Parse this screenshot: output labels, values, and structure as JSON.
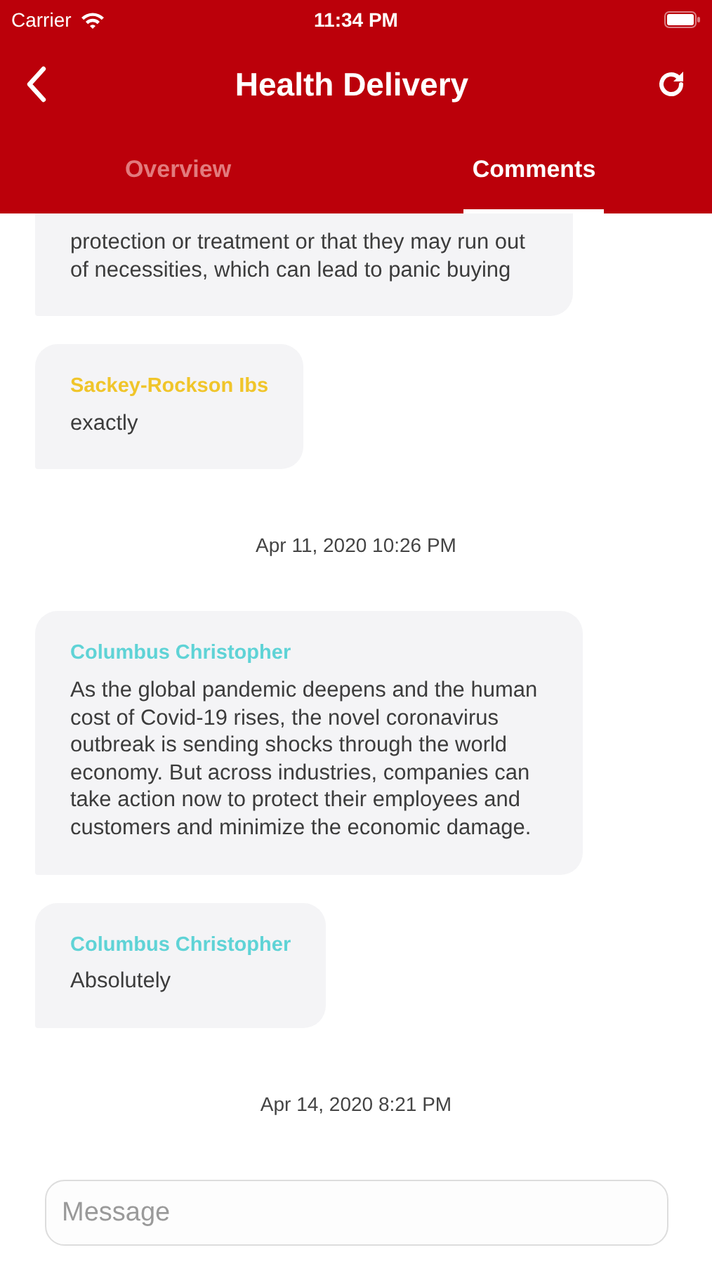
{
  "status_bar": {
    "carrier": "Carrier",
    "time": "11:34 PM"
  },
  "header": {
    "title": "Health Delivery"
  },
  "tabs": [
    {
      "label": "Overview",
      "selected": false
    },
    {
      "label": "Comments",
      "selected": true
    }
  ],
  "messages": [
    {
      "kind": "message",
      "text": "protection or treatment or that they may run out of necessities, which can lead to panic buying"
    },
    {
      "kind": "message",
      "author": "Sackey-Rockson  Ibs",
      "color": "#f0c52a",
      "text": "exactly"
    },
    {
      "kind": "timestamp",
      "text": "Apr 11, 2020 10:26 PM"
    },
    {
      "kind": "message",
      "author": "Columbus Christopher",
      "color": "#5fd3d6",
      "text": "As the global pandemic deepens and the human cost of Covid-19 rises, the novel coronavirus outbreak is sending shocks through the world economy. But across industries, companies can take action now to protect their employees and customers and minimize the economic damage."
    },
    {
      "kind": "message",
      "author": "Columbus Christopher",
      "color": "#5fd3d6",
      "text": "Absolutely"
    },
    {
      "kind": "timestamp",
      "text": "Apr 14, 2020 8:21 PM"
    }
  ],
  "composer": {
    "placeholder": "Message"
  }
}
